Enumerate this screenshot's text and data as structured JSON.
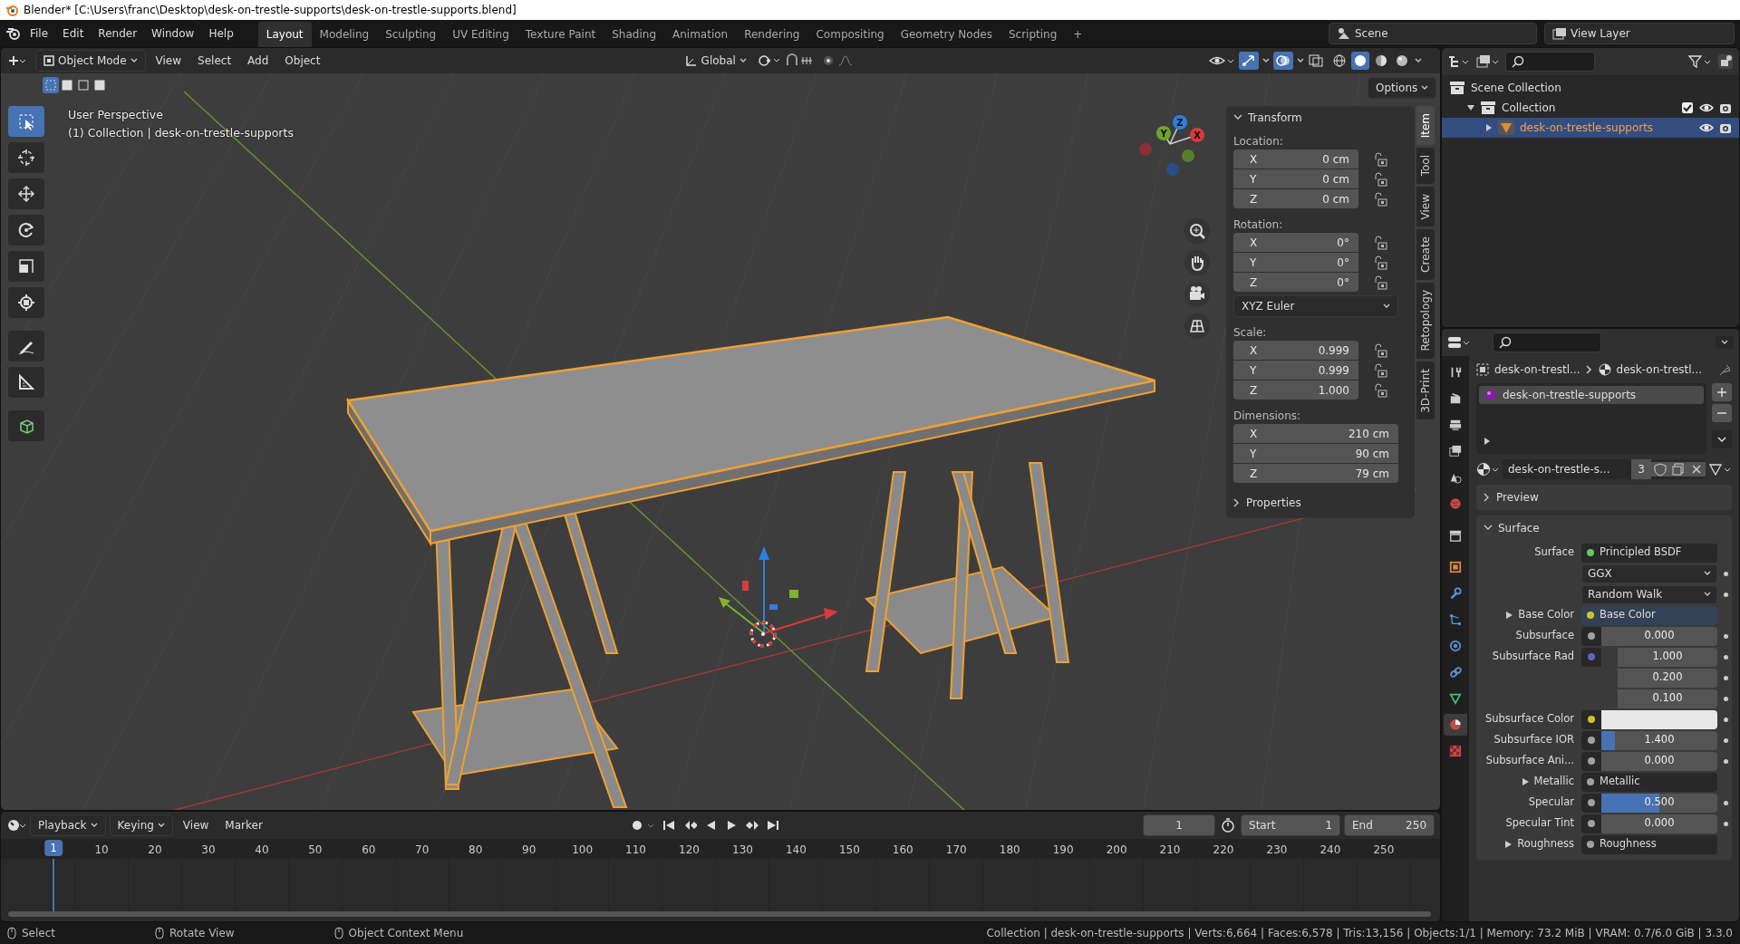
{
  "window": {
    "title": "Blender* [C:\\Users\\franc\\Desktop\\desk-on-trestle-supports\\desk-on-trestle-supports.blend]"
  },
  "menu": [
    "File",
    "Edit",
    "Render",
    "Window",
    "Help"
  ],
  "workspaces": [
    {
      "label": "Layout",
      "selected": true
    },
    {
      "label": "Modeling",
      "selected": false
    },
    {
      "label": "Sculpting",
      "selected": false
    },
    {
      "label": "UV Editing",
      "selected": false
    },
    {
      "label": "Texture Paint",
      "selected": false
    },
    {
      "label": "Shading",
      "selected": false
    },
    {
      "label": "Animation",
      "selected": false
    },
    {
      "label": "Rendering",
      "selected": false
    },
    {
      "label": "Compositing",
      "selected": false
    },
    {
      "label": "Geometry Nodes",
      "selected": false
    },
    {
      "label": "Scripting",
      "selected": false
    }
  ],
  "add_workspace": "+",
  "scene": "Scene",
  "view_layer": "View Layer",
  "viewport_header": {
    "mode": "Object Mode",
    "menus": [
      "View",
      "Select",
      "Add",
      "Object"
    ],
    "orientation": "Global",
    "options": "Options",
    "select_modes": [
      {
        "selected": true
      },
      {
        "selected": false
      },
      {
        "selected": false
      },
      {
        "selected": false
      }
    ],
    "shading": [
      {
        "selected": false
      },
      {
        "selected": true
      },
      {
        "selected": false
      },
      {
        "selected": false
      }
    ]
  },
  "viewport": {
    "overlay_lines": [
      "User Perspective",
      "(1) Collection | desk-on-trestle-supports"
    ],
    "tools": [
      {
        "kind": "select",
        "selected": true
      },
      {
        "kind": "cursor",
        "selected": false
      },
      {
        "kind": "move",
        "selected": false
      },
      {
        "kind": "rotate",
        "selected": false
      },
      {
        "kind": "scale",
        "selected": false
      },
      {
        "kind": "transform",
        "selected": false
      },
      {
        "kind": "annotate",
        "selected": false
      },
      {
        "kind": "measure",
        "selected": false
      },
      {
        "kind": "cube",
        "selected": false
      }
    ],
    "gizmo_axes": [
      "Z",
      "Y",
      "X"
    ]
  },
  "n_panel": {
    "title": "Transform",
    "groups": [
      {
        "label": "Location:",
        "locked": false,
        "fields": [
          {
            "axis": "X",
            "value": "0 cm"
          },
          {
            "axis": "Y",
            "value": "0 cm"
          },
          {
            "axis": "Z",
            "value": "0 cm"
          }
        ]
      },
      {
        "label": "Rotation:",
        "locked": false,
        "fields": [
          {
            "axis": "X",
            "value": "0°"
          },
          {
            "axis": "Y",
            "value": "0°"
          },
          {
            "axis": "Z",
            "value": "0°"
          }
        ],
        "mode": "XYZ Euler"
      },
      {
        "label": "Scale:",
        "locked": false,
        "fields": [
          {
            "axis": "X",
            "value": "0.999"
          },
          {
            "axis": "Y",
            "value": "0.999"
          },
          {
            "axis": "Z",
            "value": "1.000"
          }
        ]
      },
      {
        "label": "Dimensions:",
        "fields": [
          {
            "axis": "X",
            "value": "210 cm"
          },
          {
            "axis": "Y",
            "value": "90 cm"
          },
          {
            "axis": "Z",
            "value": "79 cm"
          }
        ]
      }
    ],
    "properties": "Properties",
    "tabs": [
      {
        "label": "Item",
        "selected": true
      },
      {
        "label": "Tool",
        "selected": false
      },
      {
        "label": "View",
        "selected": false
      },
      {
        "label": "Create",
        "selected": false
      },
      {
        "label": "Retopology",
        "selected": false
      },
      {
        "label": "3D-Print",
        "selected": false
      }
    ]
  },
  "outliner": {
    "items": [
      {
        "label": "Scene Collection",
        "selected": false,
        "children": [
          {
            "label": "Collection",
            "selected": false,
            "expanded": true,
            "checked": true,
            "children": [
              {
                "label": "desk-on-trestle-supports",
                "selected": true,
                "expanded": false
              }
            ]
          }
        ]
      }
    ]
  },
  "properties": {
    "breadcrumb": [
      "desk-on-trestl...",
      "desk-on-trestl..."
    ],
    "tabs": [
      {
        "kind": "tool",
        "selected": false
      },
      {
        "kind": "render",
        "selected": false
      },
      {
        "kind": "output",
        "selected": false
      },
      {
        "kind": "view_layer",
        "selected": false
      },
      {
        "kind": "scene",
        "selected": false
      },
      {
        "kind": "world",
        "selected": false
      },
      {
        "kind": "collection",
        "selected": false
      },
      {
        "kind": "object",
        "selected": false
      },
      {
        "kind": "modifier",
        "selected": false
      },
      {
        "kind": "particles",
        "selected": false
      },
      {
        "kind": "physics",
        "selected": false
      },
      {
        "kind": "constraint",
        "selected": false
      },
      {
        "kind": "data",
        "selected": false
      },
      {
        "kind": "material",
        "selected": true
      },
      {
        "kind": "texture",
        "selected": false
      }
    ],
    "material_slots": [
      {
        "label": "desk-on-trestle-supports",
        "selected": true
      }
    ],
    "material_name": "desk-on-trestle-s...",
    "users": "3",
    "panels": [
      {
        "label": "Preview",
        "expanded": false
      },
      {
        "label": "Surface",
        "expanded": true
      }
    ],
    "rows": [
      {
        "kind": "link",
        "label": "Surface",
        "color": "#63c763",
        "value": "Principled BSDF",
        "expandable": false
      },
      {
        "kind": "enum",
        "value": "GGX"
      },
      {
        "kind": "enum",
        "value": "Random Walk"
      },
      {
        "kind": "link",
        "label": "Base Color",
        "color": "#c7c729",
        "value": "Base Color",
        "expandable": true
      },
      {
        "kind": "number",
        "label": "Subsurface",
        "color": "#a1a1a1",
        "value": "0.000",
        "level": 0
      },
      {
        "kind": "vector",
        "label": "Subsurface Rad",
        "color": "#6363c7",
        "values": [
          "1.000",
          "0.200",
          "0.100"
        ]
      },
      {
        "kind": "color",
        "label": "Subsurface Color",
        "color": "#c7c729",
        "swatch": {
          "color": "#e8e8e8"
        }
      },
      {
        "kind": "number",
        "label": "Subsurface IOR",
        "color": "#a1a1a1",
        "value": "1.400",
        "level": 0.12
      },
      {
        "kind": "number",
        "label": "Subsurface Ani...",
        "color": "#a1a1a1",
        "value": "0.000",
        "level": 0
      },
      {
        "kind": "link",
        "label": "Metallic",
        "color": "#a1a1a1",
        "value": "Metallic",
        "expandable": true
      },
      {
        "kind": "number",
        "label": "Specular",
        "color": "#a1a1a1",
        "value": "0.500",
        "level": 0.5
      },
      {
        "kind": "number",
        "label": "Specular Tint",
        "color": "#a1a1a1",
        "value": "0.000",
        "level": 0
      },
      {
        "kind": "link",
        "label": "Roughness",
        "color": "#a1a1a1",
        "value": "Roughness",
        "expandable": true
      }
    ]
  },
  "timeline": {
    "menus": [
      "Playback",
      "Keying",
      "View",
      "Marker"
    ],
    "current_frame": "1",
    "start_label": "Start",
    "start": "1",
    "end_label": "End",
    "end": "250",
    "ruler": [
      "10",
      "20",
      "30",
      "40",
      "50",
      "60",
      "70",
      "80",
      "90",
      "100",
      "110",
      "120",
      "130",
      "140",
      "150",
      "160",
      "170",
      "180",
      "190",
      "200",
      "210",
      "220",
      "230",
      "240",
      "250"
    ],
    "playhead": "1"
  },
  "status_bar": {
    "hints": [
      "Select",
      "Rotate View",
      "Object Context Menu"
    ],
    "info": "Collection | desk-on-trestle-supports | Verts:6,664 | Faces:6,578 | Tris:13,156 | Objects:1/1 | Memory: 73.2 MiB | VRAM: 0.7/6.0 GiB | 3.3.0"
  }
}
